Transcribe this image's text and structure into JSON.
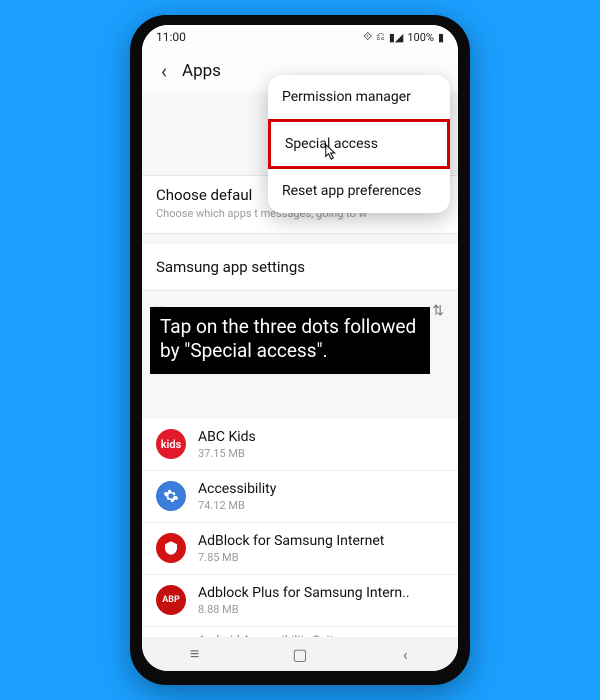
{
  "statusbar": {
    "time": "11:00",
    "battery_text": "100%"
  },
  "header": {
    "title": "Apps"
  },
  "popover": {
    "items": [
      "Permission manager",
      "Special access",
      "Reset app preferences"
    ]
  },
  "default_apps": {
    "title_visible": "Choose defaul",
    "subtitle_visible": "Choose which apps t\nmessages, going to w"
  },
  "samsung_section": {
    "label": "Samsung app settings"
  },
  "your_apps": {
    "label": "Your apps"
  },
  "instruction": {
    "text": "Tap on the three dots followed by \"Special access\"."
  },
  "apps": [
    {
      "name": "ABC Kids",
      "size": "37.15 MB",
      "icon": "kids",
      "color": "ic-red"
    },
    {
      "name": "Accessibility",
      "size": "74.12 MB",
      "icon": "gear",
      "color": "ic-blue"
    },
    {
      "name": "AdBlock for Samsung Internet",
      "size": "7.85 MB",
      "icon": "ab1",
      "color": "ic-red2"
    },
    {
      "name": "Adblock Plus for Samsung Intern..",
      "size": "8.88 MB",
      "icon": "abp",
      "color": "ic-red3"
    }
  ],
  "cutoff_app": {
    "name": "Android Accessibility Suite"
  }
}
